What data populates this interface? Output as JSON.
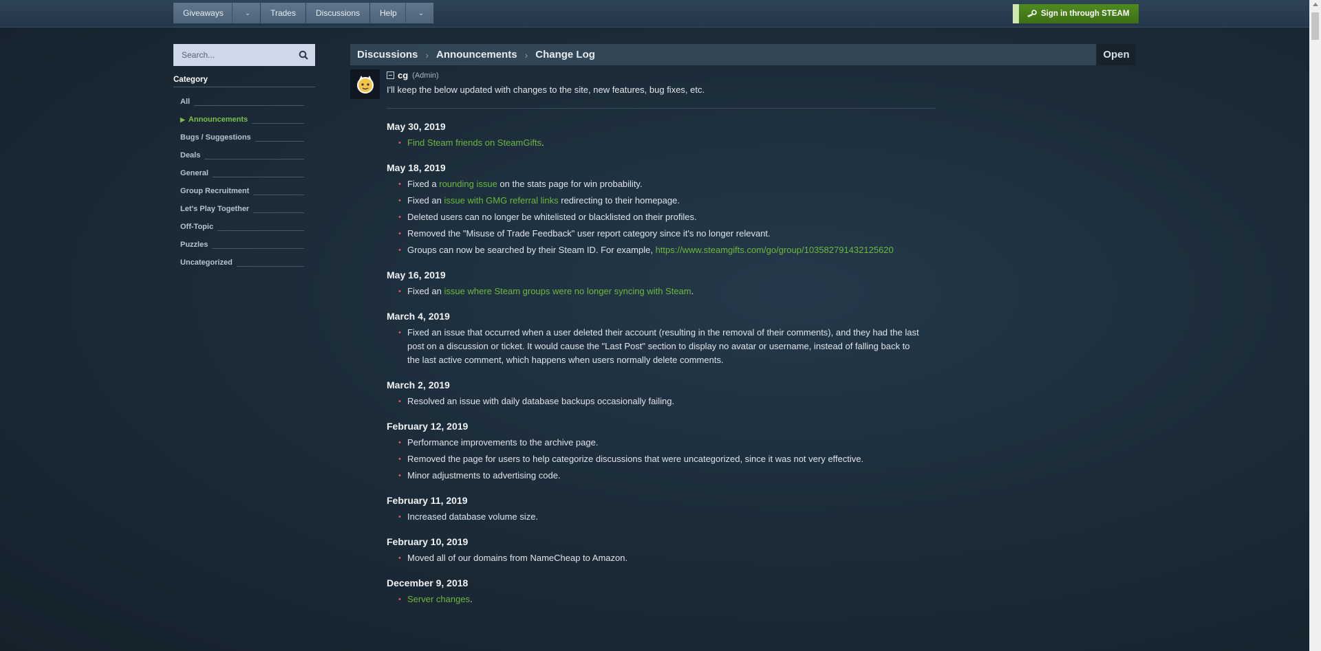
{
  "nav": {
    "items": [
      {
        "label": "Giveaways",
        "dropdown": true
      },
      {
        "label": "Trades",
        "dropdown": false
      },
      {
        "label": "Discussions",
        "dropdown": false
      },
      {
        "label": "Help",
        "dropdown": true
      }
    ],
    "signin_label": "Sign in through STEAM"
  },
  "sidebar": {
    "search_placeholder": "Search...",
    "category_title": "Category",
    "categories": [
      "All",
      "Announcements",
      "Bugs / Suggestions",
      "Deals",
      "General",
      "Group Recruitment",
      "Let's Play Together",
      "Off-Topic",
      "Puzzles",
      "Uncategorized"
    ],
    "active_category": "Announcements"
  },
  "breadcrumb": {
    "items": [
      "Discussions",
      "Announcements",
      "Change Log"
    ],
    "status": "Open"
  },
  "post": {
    "author": "cg",
    "role": "(Admin)",
    "intro": "I'll keep the below updated with changes to the site, new features, bug fixes, etc."
  },
  "changelog": [
    {
      "date": "May 30, 2019",
      "items": [
        {
          "parts": [
            {
              "t": "Find Steam friends on SteamGifts",
              "link": true
            },
            {
              "t": "."
            }
          ]
        }
      ]
    },
    {
      "date": "May 18, 2019",
      "items": [
        {
          "parts": [
            {
              "t": "Fixed a "
            },
            {
              "t": "rounding issue",
              "link": true
            },
            {
              "t": " on the stats page for win probability."
            }
          ]
        },
        {
          "parts": [
            {
              "t": "Fixed an "
            },
            {
              "t": "issue with GMG referral links",
              "link": true
            },
            {
              "t": " redirecting to their homepage."
            }
          ]
        },
        {
          "parts": [
            {
              "t": "Deleted users can no longer be whitelisted or blacklisted on their profiles."
            }
          ]
        },
        {
          "parts": [
            {
              "t": "Removed the \"Misuse of Trade Feedback\" user report category since it's no longer relevant."
            }
          ]
        },
        {
          "parts": [
            {
              "t": "Groups can now be searched by their Steam ID. For example, "
            },
            {
              "t": "https://www.steamgifts.com/go/group/103582791432125620",
              "link": true
            }
          ]
        }
      ]
    },
    {
      "date": "May 16, 2019",
      "items": [
        {
          "parts": [
            {
              "t": "Fixed an "
            },
            {
              "t": "issue where Steam groups were no longer syncing with Steam",
              "link": true
            },
            {
              "t": "."
            }
          ]
        }
      ]
    },
    {
      "date": "March 4, 2019",
      "items": [
        {
          "parts": [
            {
              "t": "Fixed an issue that occurred when a user deleted their account (resulting in the removal of their comments), and they had the last post on a discussion or ticket. It would cause the \"Last Post\" section to display no avatar or username, instead of falling back to the last active comment, which happens when users normally delete comments."
            }
          ]
        }
      ]
    },
    {
      "date": "March 2, 2019",
      "items": [
        {
          "parts": [
            {
              "t": "Resolved an issue with daily database backups occasionally failing."
            }
          ]
        }
      ]
    },
    {
      "date": "February 12, 2019",
      "items": [
        {
          "parts": [
            {
              "t": "Performance improvements to the archive page."
            }
          ]
        },
        {
          "parts": [
            {
              "t": "Removed the page for users to help categorize discussions that were uncategorized, since it was not very effective."
            }
          ]
        },
        {
          "parts": [
            {
              "t": "Minor adjustments to advertising code."
            }
          ]
        }
      ]
    },
    {
      "date": "February 11, 2019",
      "items": [
        {
          "parts": [
            {
              "t": "Increased database volume size."
            }
          ]
        }
      ]
    },
    {
      "date": "February 10, 2019",
      "items": [
        {
          "parts": [
            {
              "t": "Moved all of our domains from NameCheap to Amazon."
            }
          ]
        }
      ]
    },
    {
      "date": "December 9, 2018",
      "items": [
        {
          "parts": [
            {
              "t": "Server changes",
              "link": true
            },
            {
              "t": "."
            }
          ]
        }
      ]
    }
  ],
  "colors": {
    "link": "#6cb840",
    "accent_green": "#4f8a1e",
    "bullet": "#e05a5a"
  }
}
